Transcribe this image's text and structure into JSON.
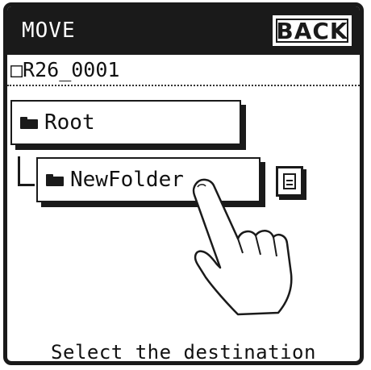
{
  "header": {
    "title": "MOVE",
    "back_label": "BACK"
  },
  "file": {
    "name": "□R26_0001"
  },
  "tree": {
    "root": {
      "label": "Root",
      "icon": "folder-icon"
    },
    "child": {
      "label": "NewFolder",
      "icon": "folder-icon"
    }
  },
  "side_button": {
    "icon": "document-icon"
  },
  "status": {
    "message": "Select the destination"
  },
  "colors": {
    "foreground": "#1a1a1a",
    "background": "#ffffff"
  }
}
